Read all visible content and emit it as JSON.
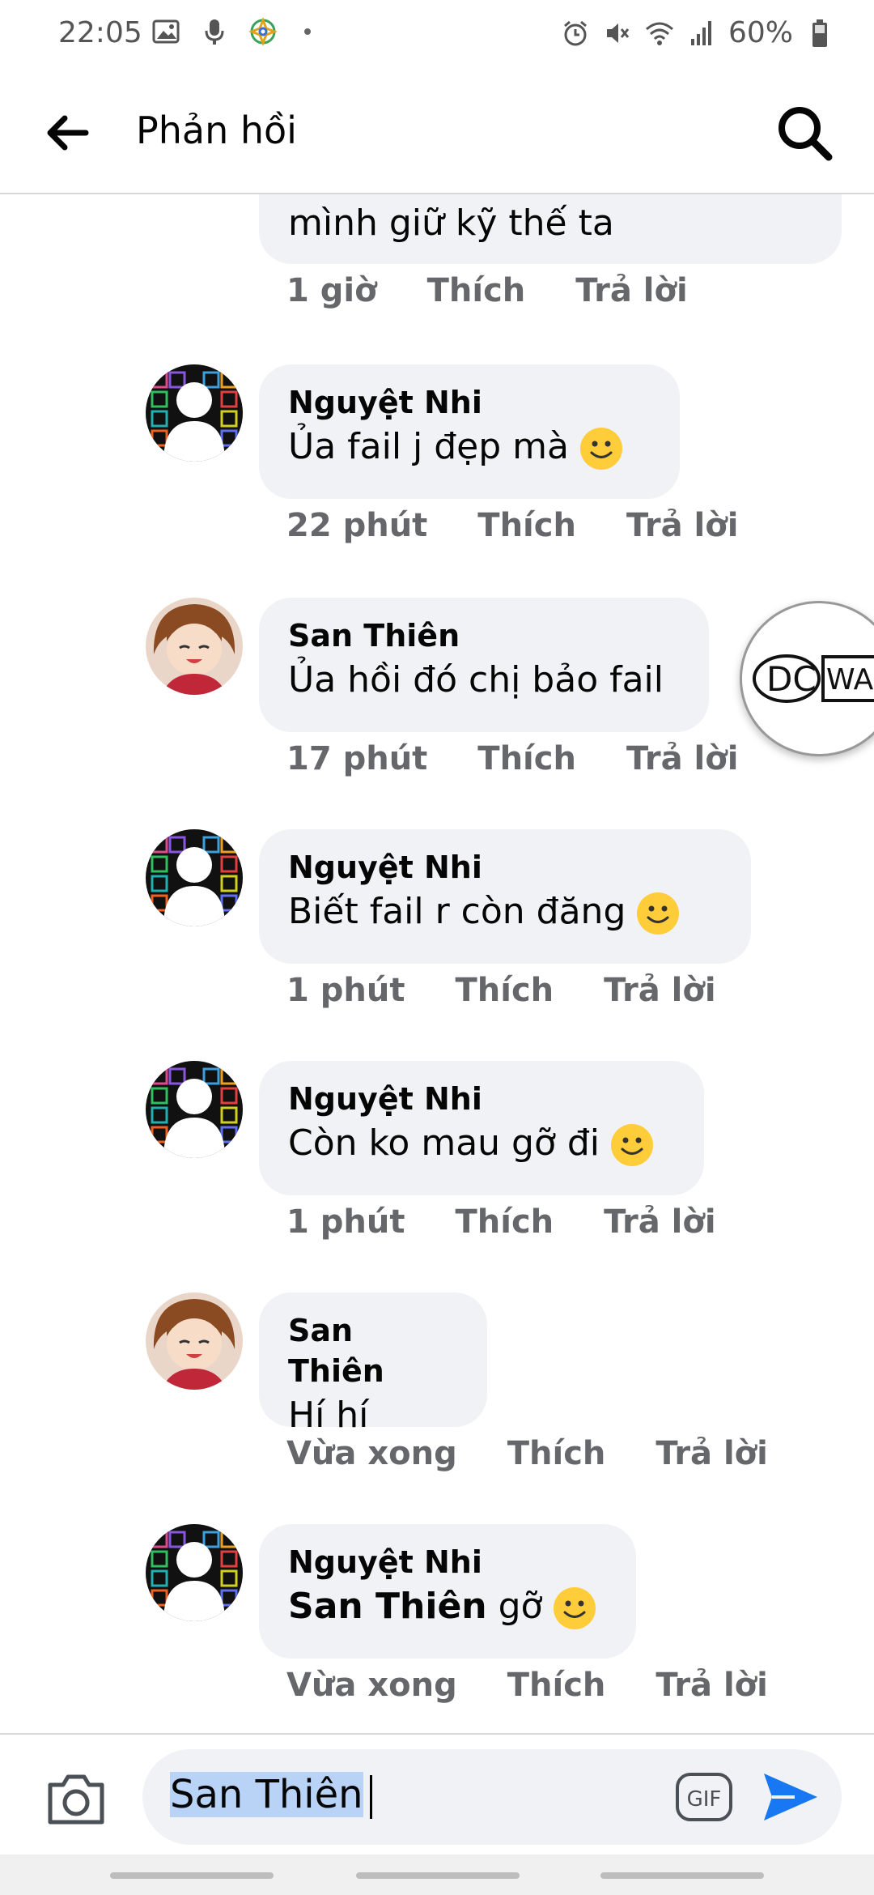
{
  "status_bar": {
    "time": "22:05",
    "battery": "60%",
    "icons_left": [
      "image-icon",
      "mic-icon",
      "app-icon"
    ],
    "icons_right": [
      "alarm-icon",
      "mute-icon",
      "wifi-icon",
      "signal-icon",
      "battery-icon"
    ]
  },
  "header": {
    "title": "Phản hồi",
    "back_icon": "arrow-left-icon",
    "search_icon": "search-icon"
  },
  "comments": [
    {
      "author": "",
      "text": "mình giữ kỹ thế ta",
      "time": "1 giờ",
      "like": "Thích",
      "reply": "Trả lời",
      "has_emoji": false
    },
    {
      "author": "Nguyệt Nhi",
      "text": "Ủa fail j đẹp mà",
      "time": "22 phút",
      "like": "Thích",
      "reply": "Trả lời",
      "has_emoji": true
    },
    {
      "author": "San Thiên",
      "text": "Ủa hồi đó chị bảo fail",
      "time": "17 phút",
      "like": "Thích",
      "reply": "Trả lời",
      "has_emoji": false
    },
    {
      "author": "Nguyệt Nhi",
      "text": "Biết fail r còn đăng",
      "time": "1 phút",
      "like": "Thích",
      "reply": "Trả lời",
      "has_emoji": true
    },
    {
      "author": "Nguyệt Nhi",
      "text": "Còn ko mau gỡ đi",
      "time": "1 phút",
      "like": "Thích",
      "reply": "Trả lời",
      "has_emoji": true
    },
    {
      "author": "San Thiên",
      "text": "Hí hí",
      "time": "Vừa xong",
      "like": "Thích",
      "reply": "Trả lời",
      "has_emoji": false
    },
    {
      "author": "Nguyệt Nhi",
      "mention": "San Thiên",
      "text": "gỡ",
      "time": "Vừa xong",
      "like": "Thích",
      "reply": "Trả lời",
      "has_emoji": true
    }
  ],
  "floating_bubble": {
    "logo_text": "DC WAC"
  },
  "composer": {
    "input_value": "San Thiên",
    "camera_icon": "camera-icon",
    "gif_label": "GIF",
    "send_icon": "send-icon"
  },
  "colors": {
    "accent": "#1877f2",
    "bubble_bg": "#f0f2f5",
    "meta_text": "#65676b"
  }
}
